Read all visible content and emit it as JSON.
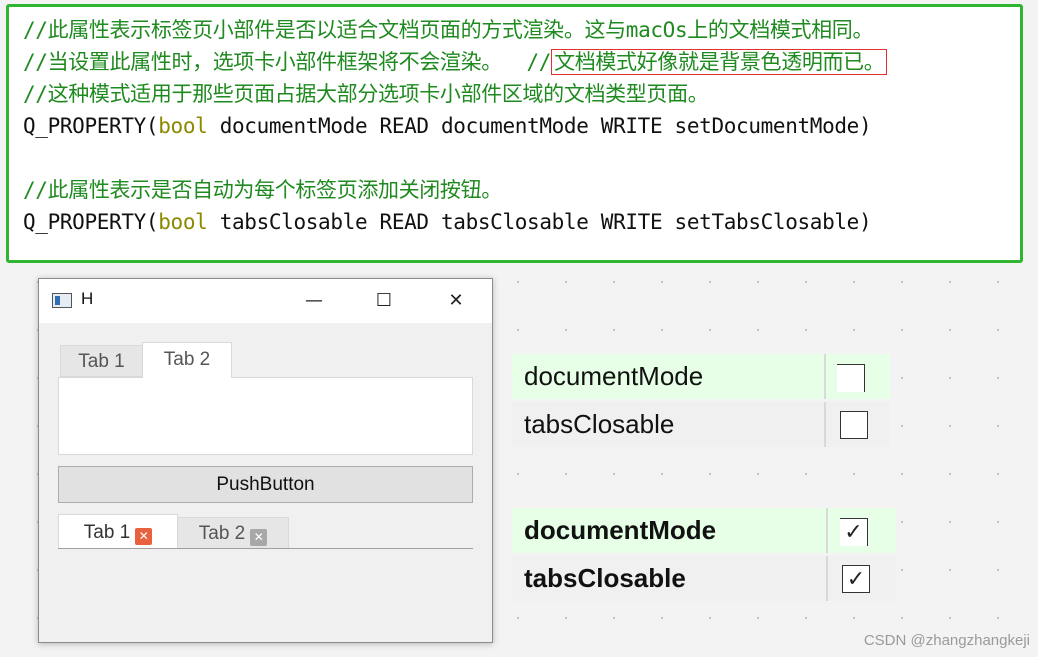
{
  "code": {
    "line1": "//此属性表示标签页小部件是否以适合文档页面的方式渲染。这与macOs上的文档模式相同。",
    "line2_comment": "//当设置此属性时，选项卡小部件框架将不会渲染。  //",
    "line2_highlight": "文档模式好像就是背景色透明而已。",
    "line3": "//这种模式适用于那些页面占据大部分选项卡小部件区域的文档类型页面。",
    "line4_prefix": "Q_PROPERTY(",
    "line4_type": "bool",
    "line4_rest": " documentMode READ documentMode WRITE setDocumentMode)",
    "line5": "//此属性表示是否自动为每个标签页添加关闭按钮。",
    "line6_prefix": "Q_PROPERTY(",
    "line6_type": "bool",
    "line6_rest": " tabsClosable READ tabsClosable WRITE setTabsClosable)"
  },
  "window": {
    "title": "H",
    "minimize": "—",
    "maximize": "☐",
    "close": "✕",
    "top_tabs": [
      "Tab 1",
      "Tab 2"
    ],
    "push_button": "PushButton",
    "bottom_tabs": [
      "Tab 1",
      "Tab 2"
    ],
    "close_glyph": "✕"
  },
  "props_unchecked": {
    "rows": [
      {
        "name": "documentMode",
        "checked": false
      },
      {
        "name": "tabsClosable",
        "checked": false
      }
    ]
  },
  "props_checked": {
    "rows": [
      {
        "name": "documentMode",
        "checked": true
      },
      {
        "name": "tabsClosable",
        "checked": true
      }
    ],
    "check_glyph": "✓"
  },
  "colors": {
    "code_border": "#2fb52f",
    "comment": "#1f8a1f",
    "keyword": "#8a8a00",
    "highlight_box": "#e53030",
    "close_active": "#e8623f",
    "close_inactive": "#a8a8a8",
    "row_green": "#e6ffe6"
  },
  "watermark": "CSDN @zhangzhangkeji"
}
